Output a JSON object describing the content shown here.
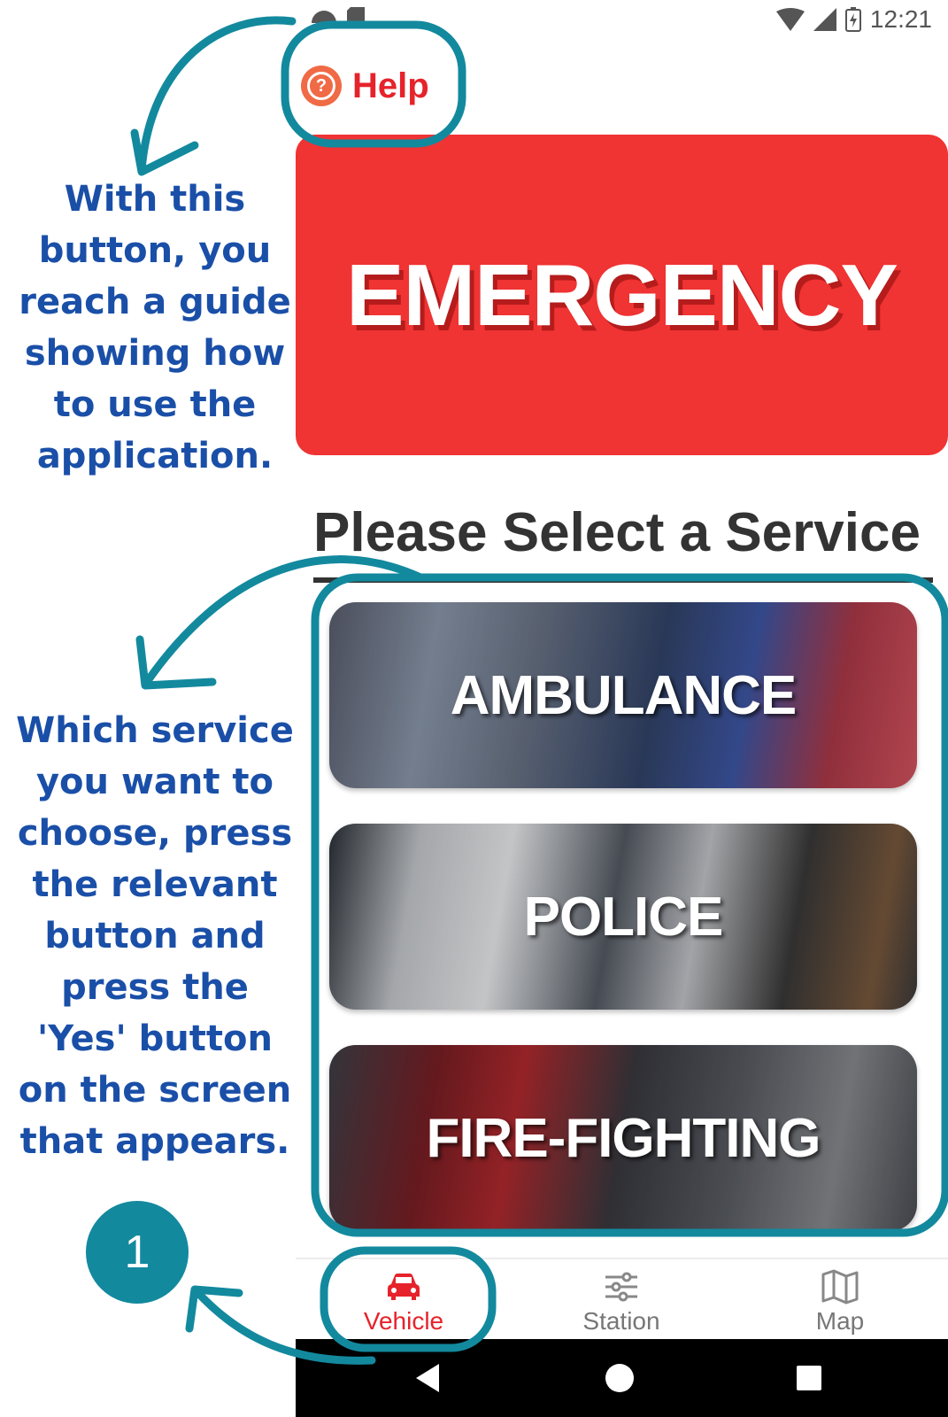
{
  "status_bar": {
    "time": "12:21"
  },
  "help": {
    "label": "Help",
    "icon": "question-circle-icon"
  },
  "emergency": {
    "label": "EMERGENCY"
  },
  "services": {
    "title": "Please Select a Service",
    "items": [
      {
        "label": "AMBULANCE"
      },
      {
        "label": "POLICE"
      },
      {
        "label": "FIRE-FIGHTING"
      }
    ]
  },
  "annotations": {
    "help_note": "With this button, you reach a guide showing how to use the application.",
    "service_note": "Which service you want to choose, press the relevant button and press the 'Yes' button on the screen that appears.",
    "step_number": "1"
  },
  "bottom_nav": {
    "items": [
      {
        "label": "Vehicle",
        "icon": "car-icon",
        "active": true
      },
      {
        "label": "Station",
        "icon": "sliders-icon",
        "active": false
      },
      {
        "label": "Map",
        "icon": "map-icon",
        "active": false
      }
    ]
  },
  "colors": {
    "emergency_red": "#f03333",
    "help_red": "#e6232b",
    "annotation_blue": "#1a4fa8",
    "callout_teal": "#13899e"
  }
}
